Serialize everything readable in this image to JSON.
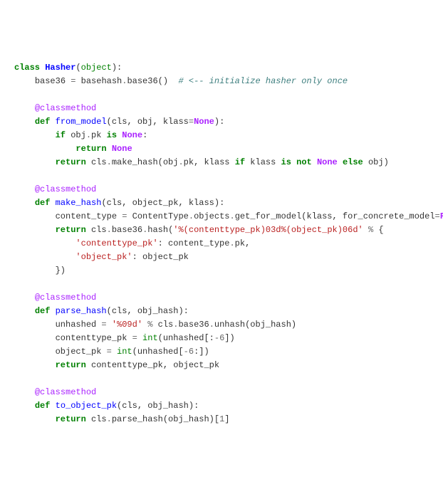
{
  "code": {
    "l1": {
      "kw_class": "class",
      "cls_name": "Hasher",
      "open": "(",
      "base": "object",
      "close": "):"
    },
    "l2": {
      "var": "base36",
      "eq": " = ",
      "call": "basehash",
      "dot": ".",
      "meth": "base36()",
      "cmt": "# <-- initialize hasher only once"
    },
    "l3": {
      "dec": "@classmethod"
    },
    "l4": {
      "kw_def": "def",
      "fn": "from_model",
      "sig": "(cls, obj, klass",
      "eq": "=",
      "none": "None",
      "close": "):"
    },
    "l5": {
      "kw_if": "if",
      "expr": " obj",
      "dot": ".",
      "attr": "pk ",
      "kw_is": "is",
      "sp": " ",
      "none": "None",
      "colon": ":"
    },
    "l6": {
      "kw_return": "return",
      "sp": " ",
      "none": "None"
    },
    "l7": {
      "kw_return": "return",
      "expr": " cls",
      "dot": ".",
      "meth": "make_hash(obj",
      "dot2": ".",
      "attr": "pk, klass ",
      "kw_if": "if",
      "mid": " klass ",
      "kw_isnot": "is not",
      "sp": " ",
      "none": "None",
      "sp2": " ",
      "kw_else": "else",
      "end": " obj)"
    },
    "l8": {
      "dec": "@classmethod"
    },
    "l9": {
      "kw_def": "def",
      "fn": "make_hash",
      "sig": "(cls, object_pk, klass):"
    },
    "l10": {
      "var": "content_type ",
      "eq": "=",
      "expr": " ContentType",
      "dot": ".",
      "p1": "objects",
      "dot2": ".",
      "meth": "get_for_model(klass, for_concrete_model",
      "eq2": "=",
      "false": "False"
    },
    "l11": {
      "kw_return": "return",
      "expr": " cls",
      "dot": ".",
      "p": "base36",
      "dot2": ".",
      "meth": "hash(",
      "str": "'%(contenttype_pk)03d%(object_pk)06d'",
      "sp": " ",
      "pct": "%",
      "brace": " {"
    },
    "l12": {
      "str": "'contenttype_pk'",
      "colon": ": content_type",
      "dot": ".",
      "attr": "pk,"
    },
    "l13": {
      "str": "'object_pk'",
      "colon": ": object_pk"
    },
    "l14": {
      "brace": "})"
    },
    "l15": {
      "dec": "@classmethod"
    },
    "l16": {
      "kw_def": "def",
      "fn": "parse_hash",
      "sig": "(cls, obj_hash):"
    },
    "l17": {
      "var": "unhashed ",
      "eq": "=",
      "sp": " ",
      "str": "'%09d'",
      "sp2": " ",
      "pct": "%",
      "expr": " cls",
      "dot": ".",
      "p": "base36",
      "dot2": ".",
      "meth": "unhash(obj_hash)"
    },
    "l18": {
      "var": "contenttype_pk ",
      "eq": "=",
      "sp": " ",
      "int": "int",
      "open": "(unhashed[:",
      "neg": "-",
      "num": "6",
      "close": "])"
    },
    "l19": {
      "var": "object_pk ",
      "eq": "=",
      "sp": " ",
      "int": "int",
      "open": "(unhashed[",
      "neg": "-",
      "num": "6",
      "close": ":])"
    },
    "l20": {
      "kw_return": "return",
      "expr": " contenttype_pk, object_pk"
    },
    "l21": {
      "dec": "@classmethod"
    },
    "l22": {
      "kw_def": "def",
      "fn": "to_object_pk",
      "sig": "(cls, obj_hash):"
    },
    "l23": {
      "kw_return": "return",
      "expr": " cls",
      "dot": ".",
      "meth": "parse_hash(obj_hash)[",
      "num": "1",
      "close": "]"
    }
  }
}
